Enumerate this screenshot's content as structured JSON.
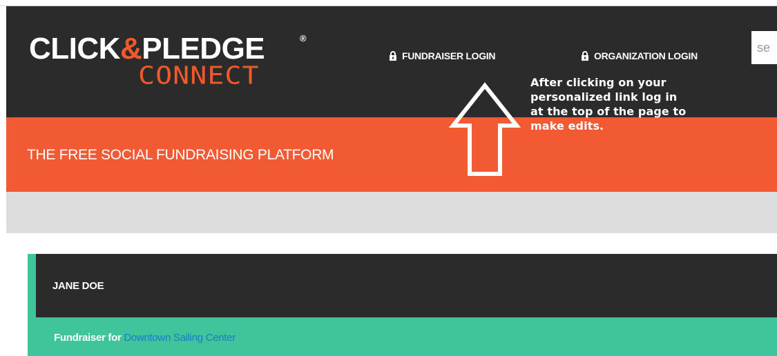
{
  "header": {
    "logo": {
      "main_prefix": "CLICK",
      "main_amp": "&",
      "main_suffix": "PLEDGE",
      "registered": "®",
      "sub": "CONNECT"
    },
    "nav": {
      "fundraiser_login": "FUNDRAISER LOGIN",
      "organization_login": "ORGANIZATION LOGIN"
    },
    "search": {
      "placeholder": "se"
    }
  },
  "banner": {
    "tagline": "THE FREE SOCIAL FUNDRAISING PLATFORM"
  },
  "annotation": {
    "lines": [
      "After clicking on your",
      "personalized link log in",
      "at the top of the page to",
      "make edits."
    ]
  },
  "profile": {
    "name": "JANE DOE",
    "fundraiser_label": "Fundraiser for",
    "organization": "Downtown Sailing Center"
  },
  "colors": {
    "header_bg": "#2b2b2b",
    "brand_orange": "#f15a33",
    "accent_green": "#3fc49b",
    "link_blue": "#1a7bc8",
    "band_gray": "#dddddd"
  },
  "icons": {
    "nav_lock": "lock-icon",
    "annotation_arrow": "up-arrow-icon"
  }
}
